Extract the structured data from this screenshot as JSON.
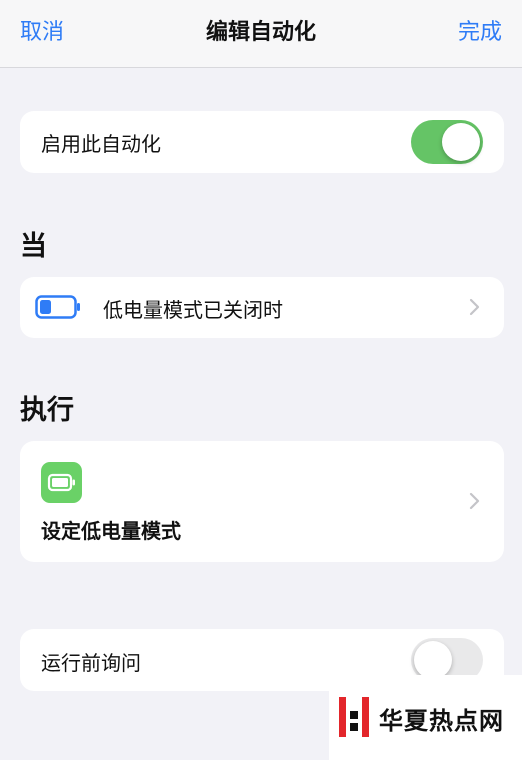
{
  "nav": {
    "cancel_label": "取消",
    "title": "编辑自动化",
    "done_label": "完成"
  },
  "enable_row": {
    "label": "启用此自动化",
    "toggle_on": true
  },
  "when_section": {
    "heading": "当",
    "trigger_label": "低电量模式已关闭时",
    "icon": "battery-icon"
  },
  "do_section": {
    "heading": "执行",
    "action_label": "设定低电量模式",
    "icon": "battery-icon"
  },
  "ask_row": {
    "label": "运行前询问",
    "toggle_on": false
  },
  "watermark": {
    "text": "华夏热点网"
  },
  "colors": {
    "accent": "#2f7cf6",
    "toggle_on": "#65c466",
    "action_icon": "#6ad167",
    "background": "#f2f2f7"
  }
}
